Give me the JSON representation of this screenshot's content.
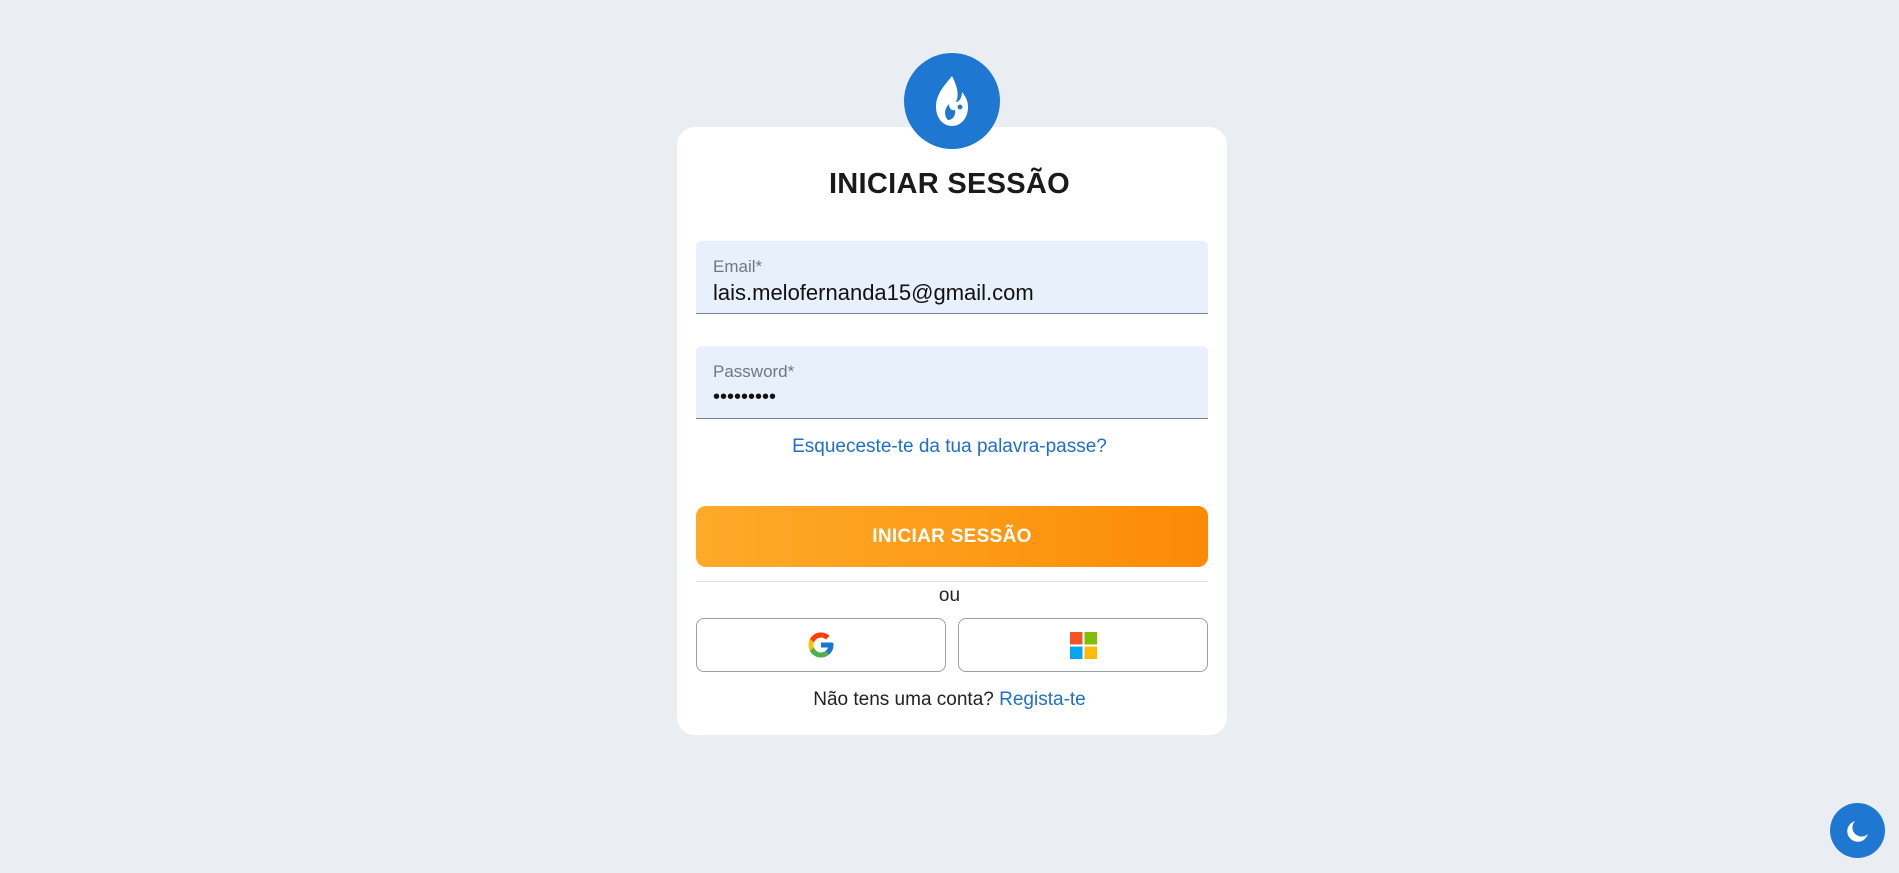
{
  "logo": {
    "icon": "flame-drop-icon",
    "color": "#1e78d2"
  },
  "login": {
    "title": "INICIAR SESSÃO",
    "email": {
      "label": "Email*",
      "value": "lais.melofernanda15@gmail.com"
    },
    "password": {
      "label": "Password*",
      "value": "•••••••••"
    },
    "forgot_link": "Esqueceste-te da tua palavra-passe?",
    "submit_label": "INICIAR SESSÃO",
    "divider_text": "ou",
    "social": [
      {
        "icon": "google-icon"
      },
      {
        "icon": "microsoft-icon"
      }
    ],
    "signup_prompt": "Não tens uma conta?",
    "signup_link": "Regista-te"
  },
  "theme_toggle": {
    "icon": "moon-icon"
  },
  "colors": {
    "background": "#eaeef2",
    "accent_blue": "#1e78d2",
    "link_blue": "#1f6fc7",
    "submit_orange": "#fd9c18",
    "field_bg": "#e8f0fc"
  }
}
